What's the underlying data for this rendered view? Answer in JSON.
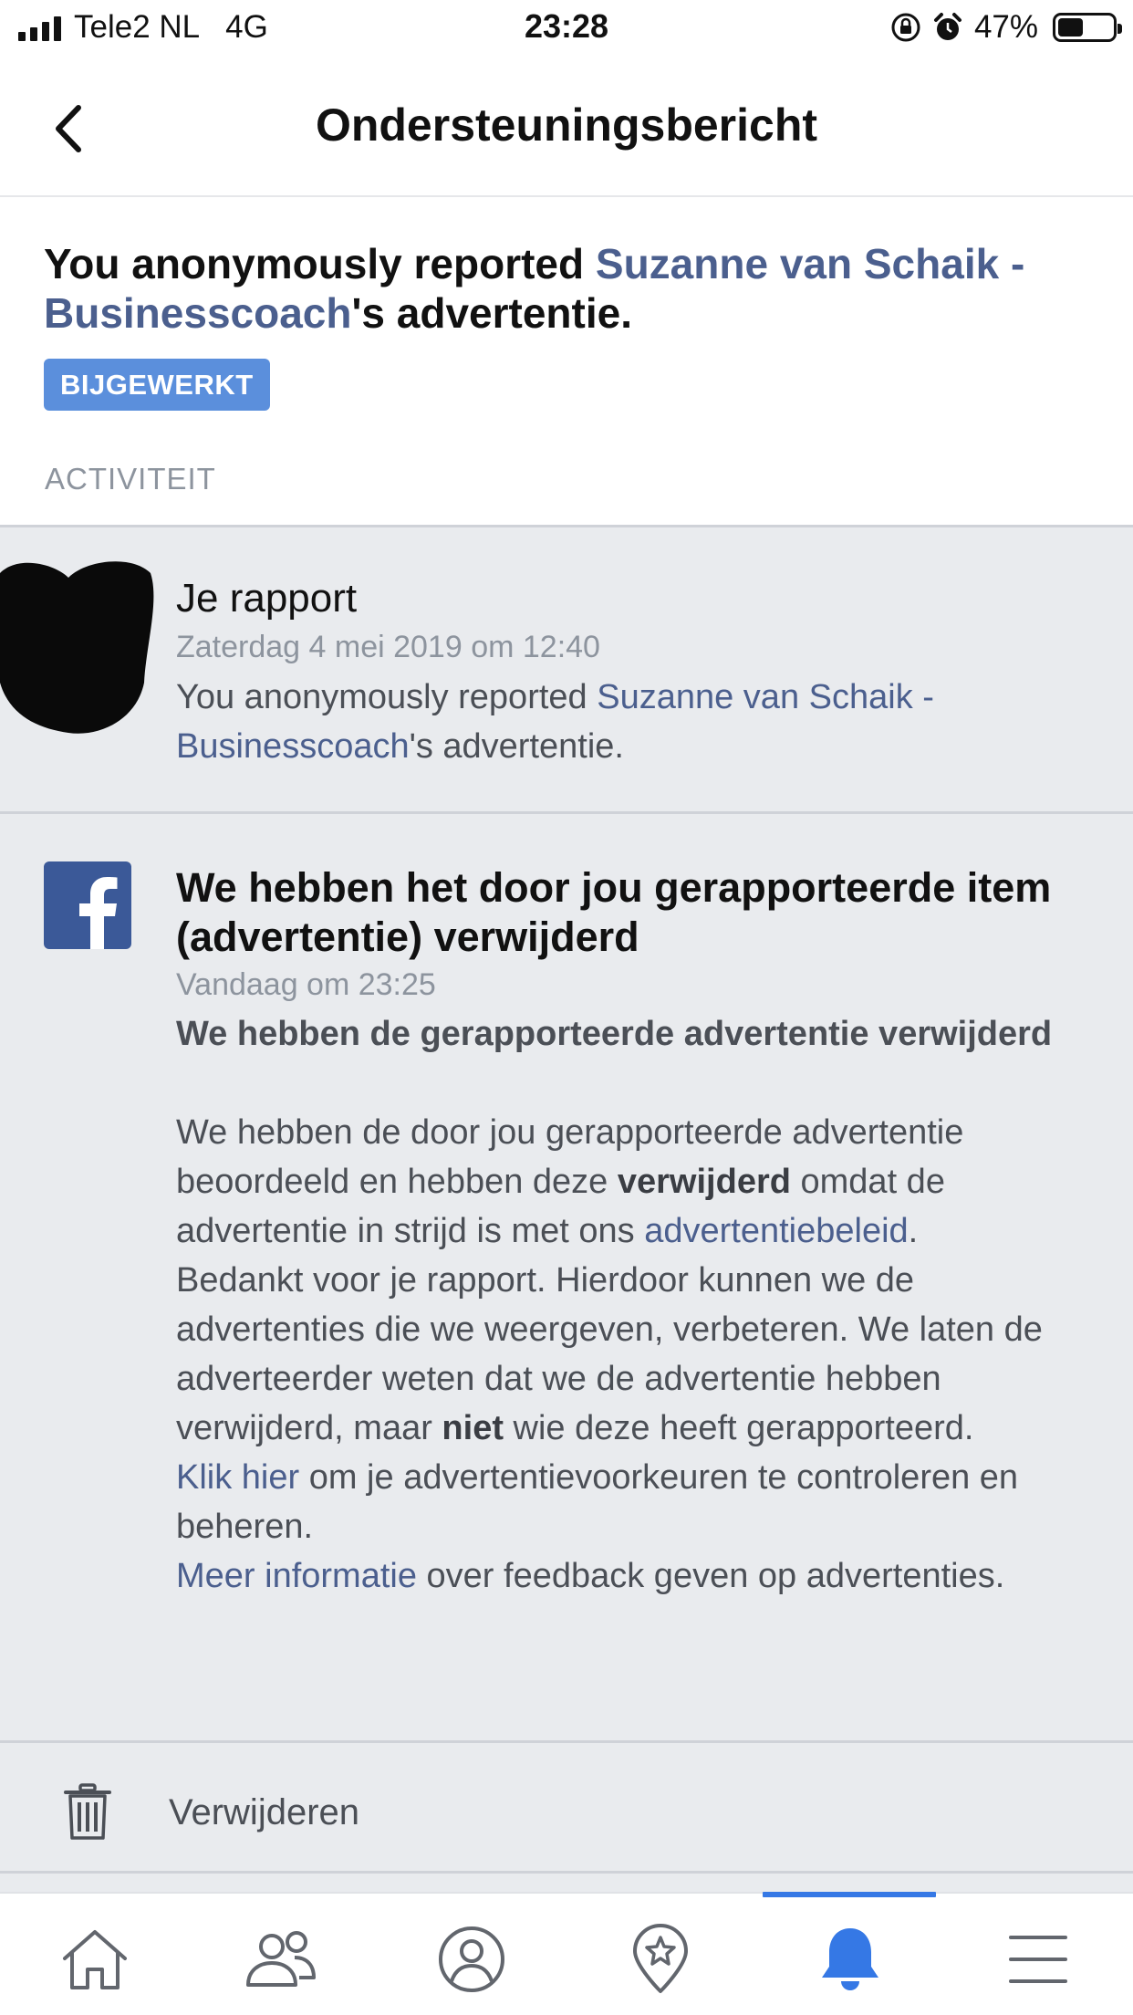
{
  "status_bar": {
    "carrier": "Tele2 NL",
    "network": "4G",
    "time": "23:28",
    "battery_percent": "47%",
    "battery_level": 0.47
  },
  "nav": {
    "title": "Ondersteuningsbericht",
    "back_icon": "chevron-left-icon"
  },
  "header": {
    "text_before": "You anonymously reported ",
    "link_name": "Suzanne van Schaik - Businesscoach",
    "text_after": "'s advertentie.",
    "badge": "BIJGEWERKT",
    "badge_color": "#5b8fdc"
  },
  "activity": {
    "section_label": "ACTIVITEIT",
    "report": {
      "title": "Je rapport",
      "date": "Zaterdag 4 mei 2019 om 12:40",
      "text_before": "You anonymously reported ",
      "link_name": "Suzanne van Schaik - Businesscoach",
      "text_after": "'s advertentie."
    },
    "update": {
      "title": "We hebben het door jou gerapporteerde item (advertentie) verwijderd",
      "date": "Vandaag om 23:25",
      "subtitle": "We hebben de gerapporteerde advertentie verwijderd",
      "p1_a": "We hebben de door jou gerapporteerde advertentie beoordeeld en hebben deze ",
      "p1_bold": "verwijderd",
      "p1_b": " omdat de advertentie in strijd is met ons ",
      "p1_link": "advertentiebeleid",
      "p1_c": ".",
      "p2_a": "Bedankt voor je rapport. Hierdoor kunnen we de advertenties die we weergeven, verbeteren. We laten de adverteerder weten dat we de advertentie hebben verwijderd, maar ",
      "p2_bold": "niet",
      "p2_b": " wie deze heeft gerapporteerd.",
      "p3_link": "Klik hier",
      "p3_text": " om je advertentievoorkeuren te controleren en beheren.",
      "p4_link": "Meer informatie",
      "p4_text": " over feedback geven op advertenties."
    },
    "delete_label": "Verwijderen"
  },
  "tabbar": {
    "tabs": [
      "home-icon",
      "friends-icon",
      "profile-icon",
      "explore-icon",
      "notifications-icon",
      "menu-icon"
    ],
    "active_tab": "notifications-icon",
    "accent_color": "#3578e5"
  }
}
